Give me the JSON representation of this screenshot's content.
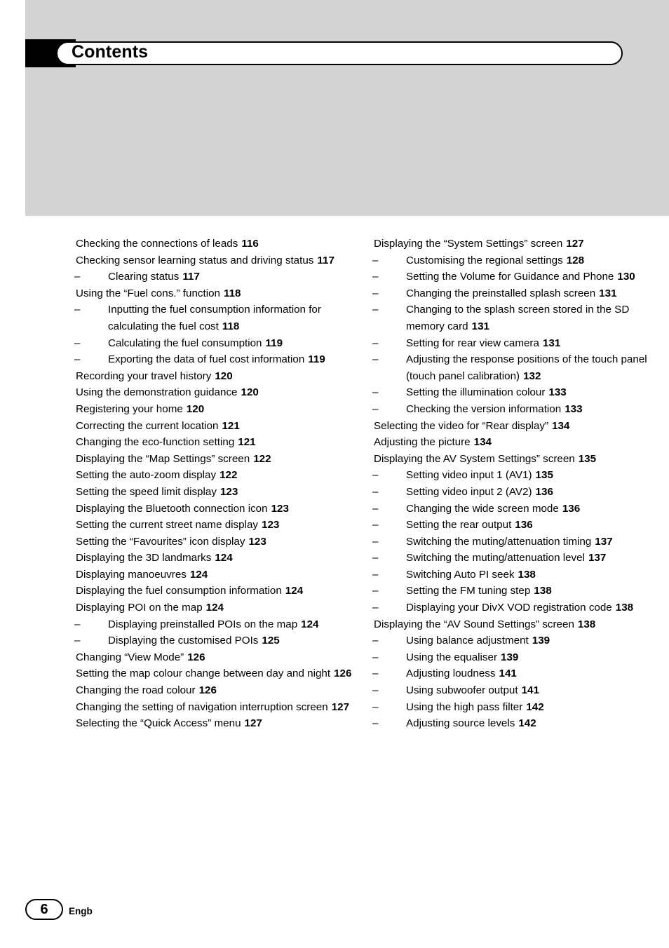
{
  "page": {
    "title": "Contents",
    "number": "6",
    "language": "Engb"
  },
  "toc": {
    "left_column": [
      {
        "level": 1,
        "text": "Checking the connections of leads",
        "page": "116"
      },
      {
        "level": 1,
        "text": "Checking sensor learning status and driving status",
        "page": "117"
      },
      {
        "level": 2,
        "text": "Clearing status",
        "page": "117"
      },
      {
        "level": 1,
        "text": "Using the “Fuel cons.” function",
        "page": "118"
      },
      {
        "level": 2,
        "text": "Inputting the fuel consumption information for calculating the fuel cost",
        "page": "118"
      },
      {
        "level": 2,
        "text": "Calculating the fuel consumption",
        "page": "119"
      },
      {
        "level": 2,
        "text": "Exporting the data of fuel cost information",
        "page": "119"
      },
      {
        "level": 1,
        "text": "Recording your travel history",
        "page": "120"
      },
      {
        "level": 1,
        "text": "Using the demonstration guidance",
        "page": "120"
      },
      {
        "level": 1,
        "text": "Registering your home",
        "page": "120"
      },
      {
        "level": 1,
        "text": "Correcting the current location",
        "page": "121"
      },
      {
        "level": 1,
        "text": "Changing the eco-function setting",
        "page": "121"
      },
      {
        "level": 1,
        "text": "Displaying the “Map Settings” screen",
        "page": "122"
      },
      {
        "level": 1,
        "text": "Setting the auto-zoom display",
        "page": "122"
      },
      {
        "level": 1,
        "text": "Setting the speed limit display",
        "page": "123"
      },
      {
        "level": 1,
        "text": "Displaying the Bluetooth connection icon",
        "page": "123"
      },
      {
        "level": 1,
        "text": "Setting the current street name display",
        "page": "123"
      },
      {
        "level": 1,
        "text": "Setting the “Favourites” icon display",
        "page": "123"
      },
      {
        "level": 1,
        "text": "Displaying the 3D landmarks",
        "page": "124"
      },
      {
        "level": 1,
        "text": "Displaying manoeuvres",
        "page": "124"
      },
      {
        "level": 1,
        "text": "Displaying the fuel consumption information",
        "page": "124"
      },
      {
        "level": 1,
        "text": "Displaying POI on the map",
        "page": "124"
      },
      {
        "level": 2,
        "text": "Displaying preinstalled POIs on the map",
        "page": "124"
      },
      {
        "level": 2,
        "text": "Displaying the customised POIs",
        "page": "125"
      },
      {
        "level": 1,
        "text": "Changing “View Mode”",
        "page": "126"
      },
      {
        "level": 1,
        "text": "Setting the map colour change between day and night",
        "page": "126"
      },
      {
        "level": 1,
        "text": "Changing the road colour",
        "page": "126"
      },
      {
        "level": 1,
        "text": "Changing the setting of navigation interruption screen",
        "page": "127"
      },
      {
        "level": 1,
        "text": "Selecting the “Quick Access” menu",
        "page": "127"
      }
    ],
    "right_column": [
      {
        "level": 1,
        "text": "Displaying the “System Settings” screen",
        "page": "127"
      },
      {
        "level": 2,
        "text": "Customising the regional settings",
        "page": "128"
      },
      {
        "level": 2,
        "text": "Setting the Volume for Guidance and Phone",
        "page": "130"
      },
      {
        "level": 2,
        "text": "Changing the preinstalled splash screen",
        "page": "131"
      },
      {
        "level": 2,
        "text": "Changing to the splash screen stored in the SD memory card",
        "page": "131"
      },
      {
        "level": 2,
        "text": "Setting for rear view camera",
        "page": "131"
      },
      {
        "level": 2,
        "text": "Adjusting the response positions of the touch panel (touch panel calibration)",
        "page": "132"
      },
      {
        "level": 2,
        "text": "Setting the illumination colour",
        "page": "133"
      },
      {
        "level": 2,
        "text": "Checking the version information",
        "page": "133"
      },
      {
        "level": 1,
        "text": "Selecting the video for “Rear display”",
        "page": "134"
      },
      {
        "level": 1,
        "text": "Adjusting the picture",
        "page": "134"
      },
      {
        "level": 1,
        "text": "Displaying the AV System Settings” screen",
        "page": "135"
      },
      {
        "level": 2,
        "text": "Setting video input 1 (AV1)",
        "page": "135"
      },
      {
        "level": 2,
        "text": "Setting video input 2 (AV2)",
        "page": "136"
      },
      {
        "level": 2,
        "text": "Changing the wide screen mode",
        "page": "136"
      },
      {
        "level": 2,
        "text": "Setting the rear output",
        "page": "136"
      },
      {
        "level": 2,
        "text": "Switching the muting/attenuation timing",
        "page": "137"
      },
      {
        "level": 2,
        "text": "Switching the muting/attenuation level",
        "page": "137"
      },
      {
        "level": 2,
        "text": "Switching Auto PI seek",
        "page": "138"
      },
      {
        "level": 2,
        "text": "Setting the FM tuning step",
        "page": "138"
      },
      {
        "level": 2,
        "text": "Displaying your DivX VOD registration code",
        "page": "138"
      },
      {
        "level": 1,
        "text": "Displaying the “AV Sound Settings” screen",
        "page": "138"
      },
      {
        "level": 2,
        "text": "Using balance adjustment",
        "page": "139"
      },
      {
        "level": 2,
        "text": "Using the equaliser",
        "page": "139"
      },
      {
        "level": 2,
        "text": "Adjusting loudness",
        "page": "141"
      },
      {
        "level": 2,
        "text": "Using subwoofer output",
        "page": "141"
      },
      {
        "level": 2,
        "text": "Using the high pass filter",
        "page": "142"
      },
      {
        "level": 2,
        "text": "Adjusting source levels",
        "page": "142"
      }
    ]
  }
}
